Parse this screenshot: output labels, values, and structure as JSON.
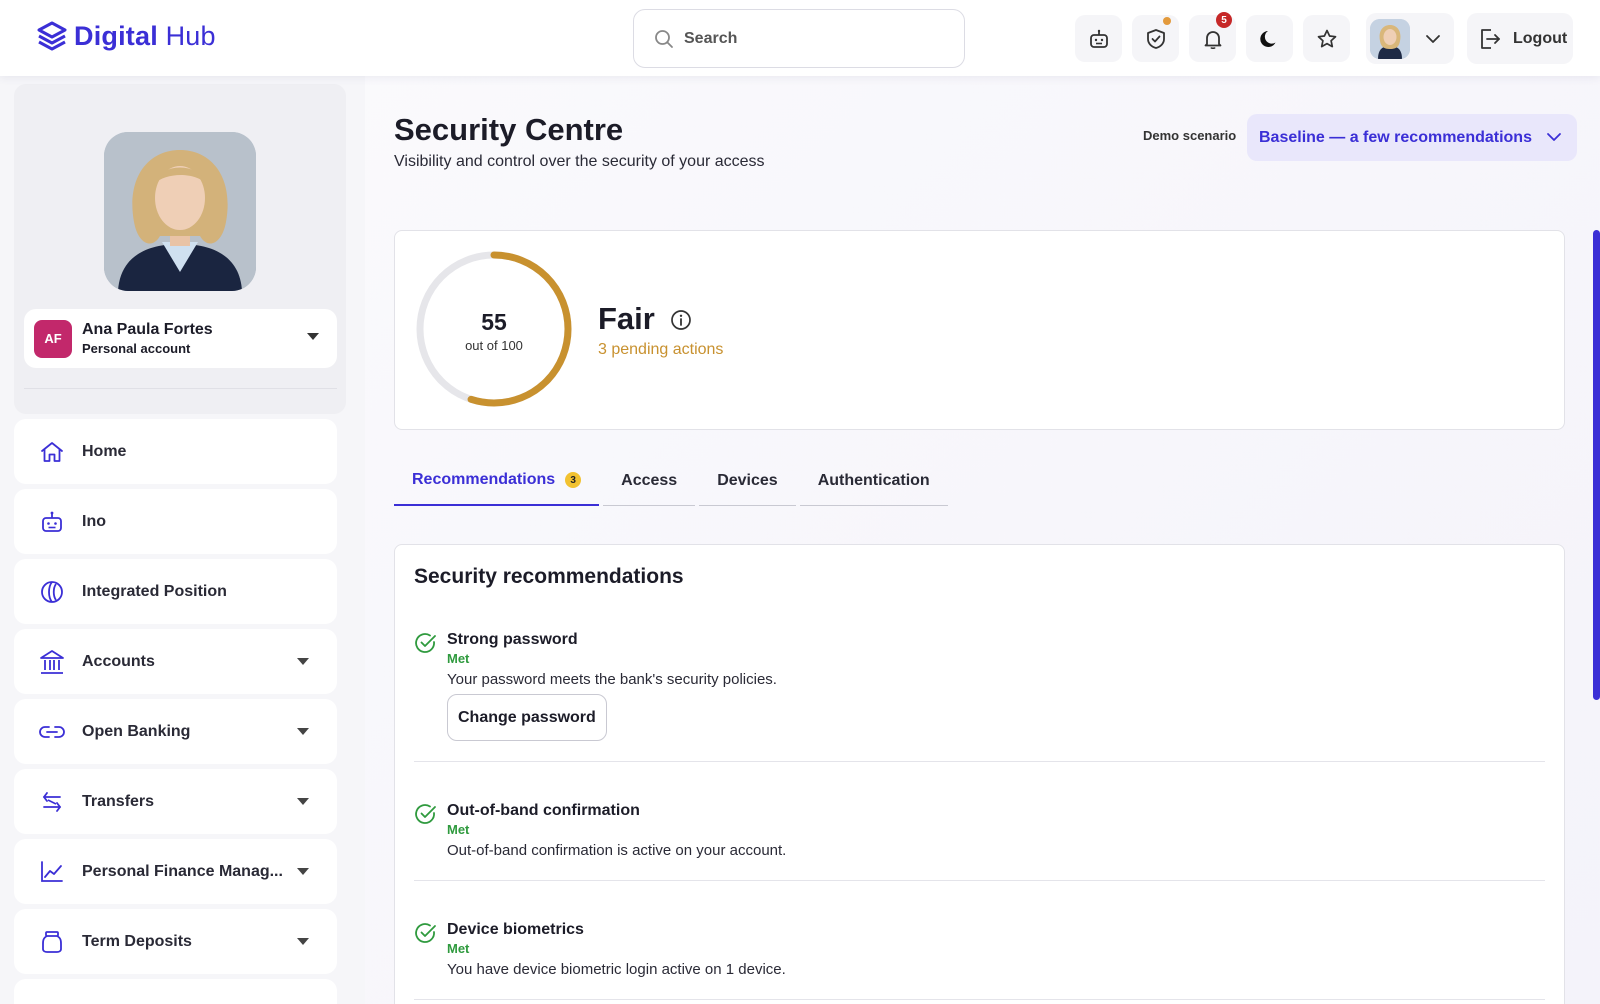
{
  "header": {
    "logo_bold": "Digital",
    "logo_light": "Hub",
    "search_placeholder": "Search",
    "notifications_count": "5",
    "logout_label": "Logout"
  },
  "sidebar": {
    "profile": {
      "initials": "AF",
      "name": "Ana Paula Fortes",
      "account_type": "Personal account"
    },
    "items": [
      {
        "label": "Home",
        "icon": "home-icon",
        "expandable": false
      },
      {
        "label": "Ino",
        "icon": "robot-icon",
        "expandable": false
      },
      {
        "label": "Integrated Position",
        "icon": "pie-chart-icon",
        "expandable": false
      },
      {
        "label": "Accounts",
        "icon": "bank-icon",
        "expandable": true
      },
      {
        "label": "Open Banking",
        "icon": "link-icon",
        "expandable": true
      },
      {
        "label": "Transfers",
        "icon": "transfer-icon",
        "expandable": true
      },
      {
        "label": "Personal Finance Manag...",
        "icon": "line-chart-icon",
        "expandable": true
      },
      {
        "label": "Term Deposits",
        "icon": "jar-icon",
        "expandable": true
      }
    ]
  },
  "main": {
    "title": "Security Centre",
    "subtitle": "Visibility and control over the security of your access",
    "demo_label": "Demo scenario",
    "demo_value": "Baseline — a few recommendations",
    "score": {
      "value": "55",
      "out_of": "out of 100",
      "fraction": 0.55,
      "rating": "Fair",
      "pending": "3 pending actions"
    },
    "tabs": [
      {
        "label": "Recommendations",
        "badge": "3",
        "active": true
      },
      {
        "label": "Access",
        "active": false
      },
      {
        "label": "Devices",
        "active": false
      },
      {
        "label": "Authentication",
        "active": false
      }
    ],
    "recommendations": {
      "title": "Security recommendations",
      "items": [
        {
          "name": "Strong password",
          "status": "Met",
          "description": "Your password meets the bank's security policies.",
          "action": "Change password"
        },
        {
          "name": "Out-of-band confirmation",
          "status": "Met",
          "description": "Out-of-band confirmation is active on your account."
        },
        {
          "name": "Device biometrics",
          "status": "Met",
          "description": "You have device biometric login active on 1 device."
        }
      ]
    }
  },
  "colors": {
    "brand": "#3b2fd6",
    "score_ring": "#c8912f",
    "success": "#2f9a3e",
    "avatar_badge": "#c2286b"
  }
}
